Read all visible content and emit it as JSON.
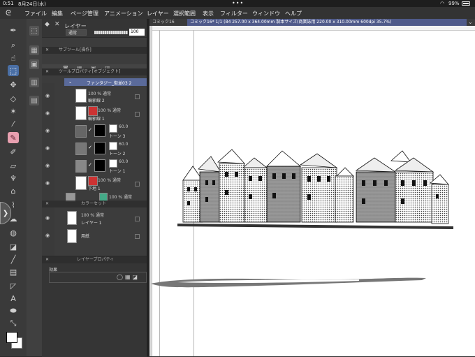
{
  "status": {
    "time": "0:51",
    "date": "8月24日(水)",
    "battery": "99%"
  },
  "menu": {
    "items": [
      "ファイル",
      "編集",
      "ページ管理",
      "アニメーション",
      "レイヤー",
      "選択範囲",
      "表示",
      "フィルター",
      "ウィンドウ",
      "ヘルプ"
    ]
  },
  "tools": [
    "zoom-icon",
    "move-icon",
    "select-icon",
    "hand-icon",
    "eyedropper-icon",
    "pen-icon",
    "brush-icon",
    "eraser-icon",
    "fill-icon",
    "gradient-icon",
    "line-icon",
    "frame-icon",
    "text-icon",
    "balloon-icon",
    "correct-icon"
  ],
  "layer_panel": {
    "tab_label": "レイヤー",
    "blend_mode": "通常",
    "opacity": "100",
    "subtool_header": "サブツール[操作]",
    "toolprop_header": "ツールプロパティ[オブジェクト]",
    "folder_name": "ファンタジー_街並03 2",
    "layers": [
      {
        "opacity": "100 %",
        "mode": "通常",
        "name": "輪郭線 2"
      },
      {
        "opacity": "100 %",
        "mode": "通常",
        "name": "輪郭線 1"
      },
      {
        "opacity": "60.0",
        "name": "トーン 3"
      },
      {
        "opacity": "60.0",
        "name": "トーン 2"
      },
      {
        "opacity": "60.0",
        "name": "トーン 1"
      },
      {
        "opacity": "100 %",
        "mode": "通常",
        "name": "下地 1"
      },
      {
        "opacity": "100 %",
        "mode": "通常",
        "name": ""
      },
      {
        "opacity": "100 %",
        "mode": "通常",
        "name": "レイヤー 1"
      },
      {
        "opacity": "",
        "mode": "",
        "name": "用紙"
      }
    ],
    "colorset_header": "カラーセット"
  },
  "property_panel": {
    "header": "レイヤープロパティ",
    "effect_label": "効果"
  },
  "canvas": {
    "tab1": "コミック16",
    "tab2": "コミック16* 1/1 (B4 257.00 x 364.00mm 製本サイズ(商業誌用 220.00 x 310.00mm 600dpi 35.7%)"
  }
}
